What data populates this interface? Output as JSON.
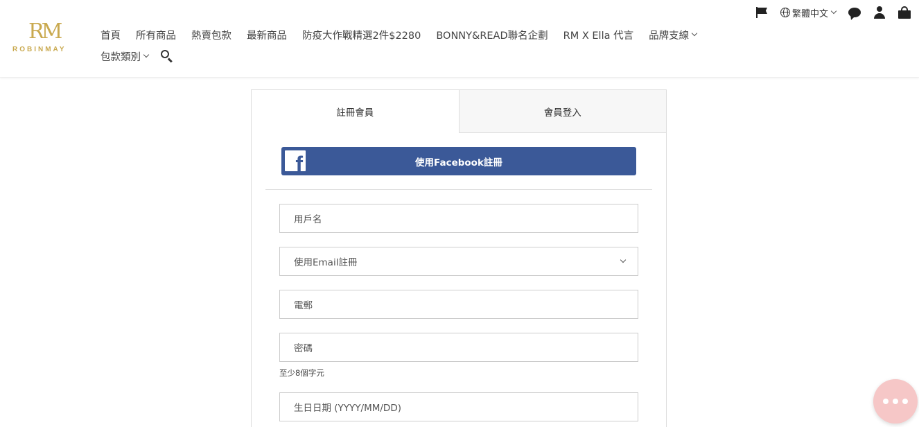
{
  "logo": {
    "mark": "RM",
    "text": "ROBINMAY"
  },
  "nav": {
    "row1": [
      "首頁",
      "所有商品",
      "熱賣包款",
      "最新商品",
      "防疫大作戰精選2件$2280",
      "BONNY&READ聯名企劃",
      "RM X Ella 代言",
      "品牌支線"
    ],
    "row2": [
      "包款類別"
    ]
  },
  "util": {
    "language": "繁體中文"
  },
  "tabs": {
    "register": "註冊會員",
    "login": "會員登入"
  },
  "facebook": {
    "label": "使用Facebook註冊",
    "icon": "f"
  },
  "form": {
    "username_placeholder": "用戶名",
    "method_value": "使用Email註冊",
    "email_placeholder": "電郵",
    "password_placeholder": "密碼",
    "password_hint": "至少8個字元",
    "birthday_placeholder": "生日日期 (YYYY/MM/DD)"
  },
  "colors": {
    "brand_gold": "#c9a94f",
    "facebook_blue": "#3b5998",
    "chat_pink": "#f6c7c7"
  }
}
